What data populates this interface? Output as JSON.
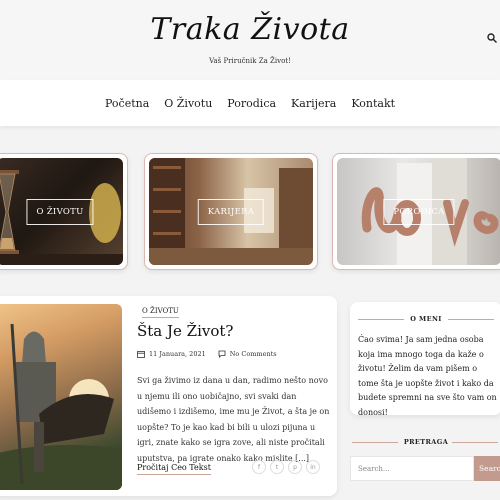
{
  "site": {
    "logo": "Traka Života",
    "tagline": "Vaš Priručnik Za Život!"
  },
  "nav": {
    "items": [
      "Početna",
      "O Životu",
      "Porodica",
      "Karijera",
      "Kontakt"
    ]
  },
  "categories": [
    {
      "label": "O ŽIVOTU"
    },
    {
      "label": "KARIJERA"
    },
    {
      "label": "PORODICA"
    }
  ],
  "post": {
    "category": "O ŽIVOTU",
    "title": "Šta Je Život?",
    "date": "11 Januara, 2021",
    "comments": "No Comments",
    "excerpt": "Svi ga živimo iz dana u dan, radimo nešto novo u njemu ili ono uobičajno, svi svaki dan udišemo i izdišemo, ime mu je Život, a šta je on uopšte? To je kao kad bi bili u ulozi pijuna u igri, znate kako se igra zove, ali niste pročitali uputstva, pa igrate onako kako mislite [...]",
    "read_more": "Pročitaj Ceo Tekst",
    "share_icons": [
      "facebook-icon",
      "twitter-icon",
      "pinterest-icon",
      "linkedin-icon"
    ]
  },
  "sidebar": {
    "about_title": "O MENI",
    "about_text": "Ćao svima! Ja sam jedna osoba koja ima mnogo toga da kaže o životu! Želim da vam pišem o tome šta je uopšte život i kako da budete spremni na sve što vam on donosi!",
    "search_title": "PRETRAGA",
    "search_placeholder": "Search...",
    "search_button": "Search"
  },
  "colors": {
    "accent": "#c39b8e",
    "background": "#f3f3f3"
  }
}
